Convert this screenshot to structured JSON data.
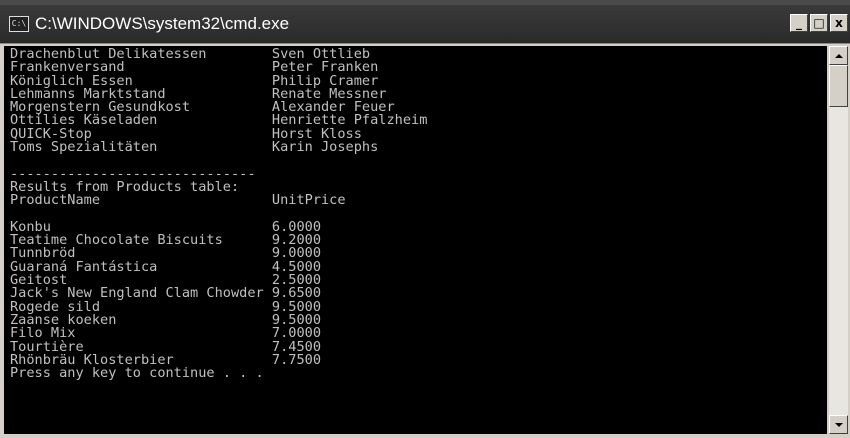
{
  "window": {
    "title": "C:\\WINDOWS\\system32\\cmd.exe",
    "icon_glyph": "C:\\",
    "buttons": {
      "minimize": "_",
      "maximize": "□",
      "close": "x"
    }
  },
  "console": {
    "lines": [
      "Drachenblut Delikatessen        Sven Ottlieb",
      "Frankenversand                  Peter Franken",
      "Königlich Essen                 Philip Cramer",
      "Lehmanns Marktstand             Renate Messner",
      "Morgenstern Gesundkost          Alexander Feuer",
      "Ottilies Käseladen              Henriette Pfalzheim",
      "QUICK-Stop                      Horst Kloss",
      "Toms Spezialitäten              Karin Josephs",
      "",
      "------------------------------",
      "Results from Products table:",
      "ProductName                     UnitPrice",
      "",
      "Konbu                           6.0000",
      "Teatime Chocolate Biscuits      9.2000",
      "Tunnbröd                        9.0000",
      "Guaraná Fantástica              4.5000",
      "Geitost                         2.5000",
      "Jack's New England Clam Chowder 9.6500",
      "Rogede sild                     9.5000",
      "Zaanse koeken                   9.5000",
      "Filo Mix                        7.0000",
      "Tourtière                       7.4500",
      "Rhönbräu Klosterbier            7.7500",
      "Press any key to continue . . ."
    ]
  },
  "colors": {
    "console_bg": "#000000",
    "console_fg": "#c0c0c0",
    "titlebar": "#2e2e2e"
  },
  "icons": {
    "app": "console-icon",
    "scroll_up": "arrow-up-icon",
    "scroll_down": "arrow-down-icon"
  }
}
